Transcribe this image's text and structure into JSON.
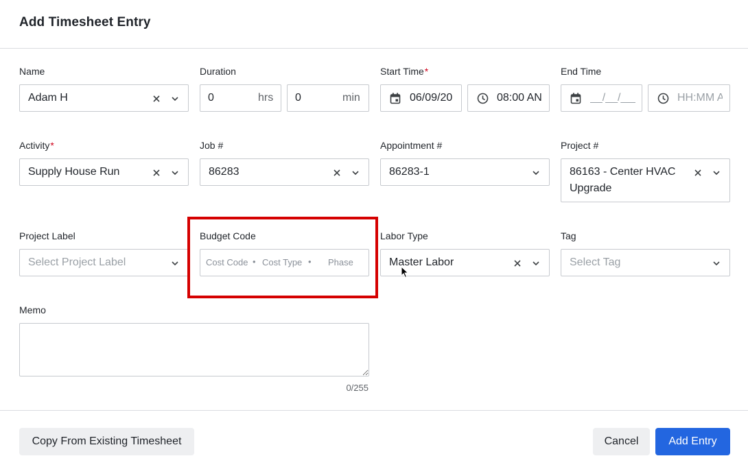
{
  "dialog": {
    "title": "Add Timesheet Entry"
  },
  "fields": {
    "name": {
      "label": "Name",
      "value": "Adam H"
    },
    "duration": {
      "label": "Duration",
      "hours_value": "0",
      "hours_unit": "hrs",
      "minutes_value": "0",
      "minutes_unit": "min"
    },
    "start_time": {
      "label": "Start Time",
      "required_mark": "*",
      "date_value": "06/09/20",
      "time_value": "08:00 AN"
    },
    "end_time": {
      "label": "End Time",
      "date_placeholder": "__/__/___",
      "time_placeholder": "HH:MM A"
    },
    "activity": {
      "label": "Activity",
      "required_mark": "*",
      "value": "Supply House Run"
    },
    "job": {
      "label": "Job #",
      "value": "86283"
    },
    "appointment": {
      "label": "Appointment #",
      "value": "86283-1"
    },
    "project": {
      "label": "Project #",
      "value_line1": "86163 - Center HVAC",
      "value_line2": "Upgrade"
    },
    "project_label": {
      "label": "Project Label",
      "placeholder": "Select Project Label"
    },
    "budget_code": {
      "label": "Budget Code",
      "cost_code": "Cost Code",
      "cost_type": "Cost Type",
      "phase": "Phase",
      "separator": "•"
    },
    "labor_type": {
      "label": "Labor Type",
      "value": "Master Labor"
    },
    "tag": {
      "label": "Tag",
      "placeholder": "Select Tag"
    },
    "memo": {
      "label": "Memo",
      "counter": "0/255"
    }
  },
  "footer": {
    "copy_label": "Copy From Existing Timesheet",
    "cancel_label": "Cancel",
    "add_label": "Add Entry"
  },
  "colors": {
    "primary": "#2366e0",
    "required": "#d0021b",
    "highlight": "#d50000"
  }
}
